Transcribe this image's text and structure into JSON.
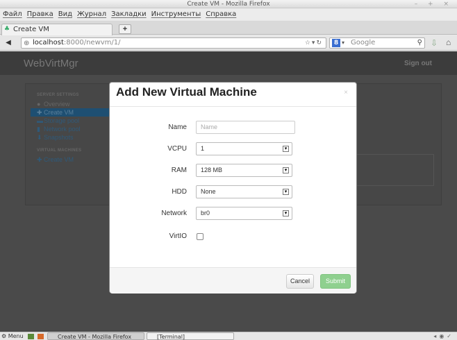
{
  "window": {
    "title": "Create VM - Mozilla Firefox",
    "controls": "– + ×"
  },
  "menu": [
    "Файл",
    "Правка",
    "Вид",
    "Журнал",
    "Закладки",
    "Инструменты",
    "Справка"
  ],
  "tab": {
    "label": "Create VM",
    "new_tab": "+"
  },
  "nav": {
    "url_host": "localhost",
    "url_rest": ":8000/newvm/1/",
    "search_placeholder": "Google",
    "search_engine_letter": "8"
  },
  "app": {
    "brand": "WebVirtMgr",
    "signout": "Sign out",
    "sidebar": {
      "server_heading": "SERVER SETTINGS",
      "items": [
        {
          "label": "Overview",
          "icon": "info-icon"
        },
        {
          "label": "Create VM",
          "icon": "plus-icon"
        },
        {
          "label": "Storage pool",
          "icon": "folder-icon"
        },
        {
          "label": "Network pool",
          "icon": "signal-icon"
        },
        {
          "label": "Snapshots",
          "icon": "download-icon"
        }
      ],
      "vm_heading": "VIRTUAL MACHINES",
      "vm_items": [
        {
          "label": "Create VM",
          "icon": "plus-icon"
        }
      ]
    }
  },
  "modal": {
    "title": "Add New Virtual Machine",
    "close": "×",
    "fields": {
      "name": {
        "label": "Name",
        "placeholder": "Name"
      },
      "vcpu": {
        "label": "VCPU",
        "value": "1"
      },
      "ram": {
        "label": "RAM",
        "value": "128 MB"
      },
      "hdd": {
        "label": "HDD",
        "value": "None"
      },
      "network": {
        "label": "Network",
        "value": "br0"
      },
      "virtio": {
        "label": "VirtIO",
        "checked": false
      }
    },
    "cancel": "Cancel",
    "submit": "Submit"
  },
  "taskbar": {
    "menu": "Menu",
    "tasks": [
      "Create VM - Mozilla Firefox",
      "[Terminal]"
    ]
  },
  "colors": {
    "submit": "#8fd08f",
    "active_nav": "#1e4f72"
  }
}
